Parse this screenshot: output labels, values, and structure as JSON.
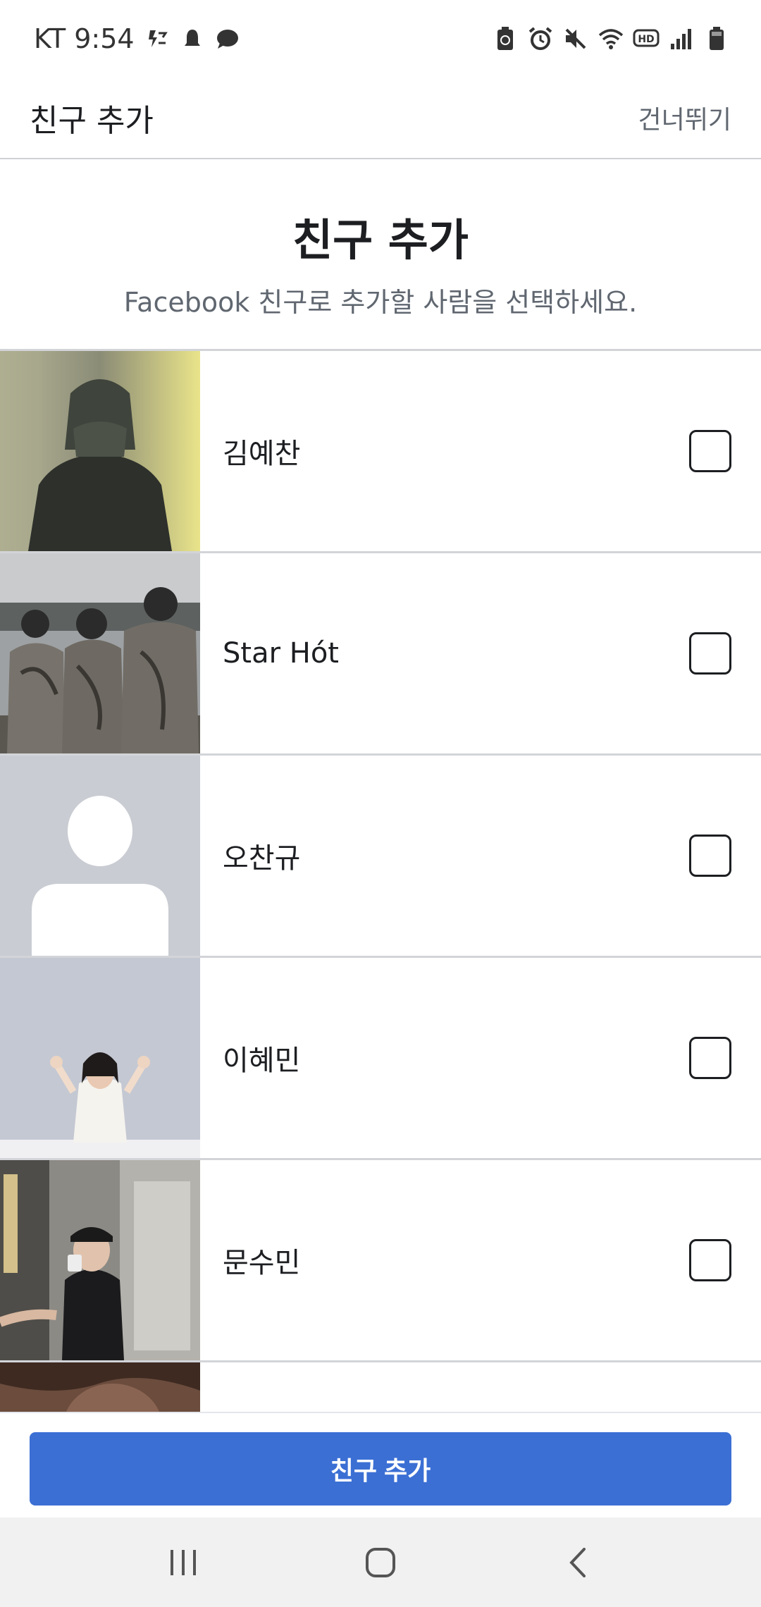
{
  "status_bar": {
    "carrier_time": "KT 9:54",
    "icons_left": [
      "flash-off-icon",
      "notification-icon",
      "chat-icon"
    ],
    "icons_right": [
      "battery-saver-icon",
      "alarm-icon",
      "mute-icon",
      "wifi-icon",
      "hd-icon",
      "signal-icon",
      "battery-icon"
    ]
  },
  "header": {
    "title": "친구 추가",
    "skip_label": "건너뛰기"
  },
  "intro": {
    "title": "친구 추가",
    "subtitle": "Facebook 친구로 추가할 사람을 선택하세요."
  },
  "friends": [
    {
      "name": "김예찬",
      "checked": false
    },
    {
      "name": "Star Hót",
      "checked": false
    },
    {
      "name": "오찬규",
      "checked": false
    },
    {
      "name": "이혜민",
      "checked": false
    },
    {
      "name": "문수민",
      "checked": false
    },
    {
      "name": "",
      "checked": false
    }
  ],
  "action": {
    "add_label": "친구 추가"
  },
  "colors": {
    "primary": "#3b6fd4",
    "divider": "#d2d4d8",
    "text": "#1c1e21",
    "secondary_text": "#606770"
  }
}
